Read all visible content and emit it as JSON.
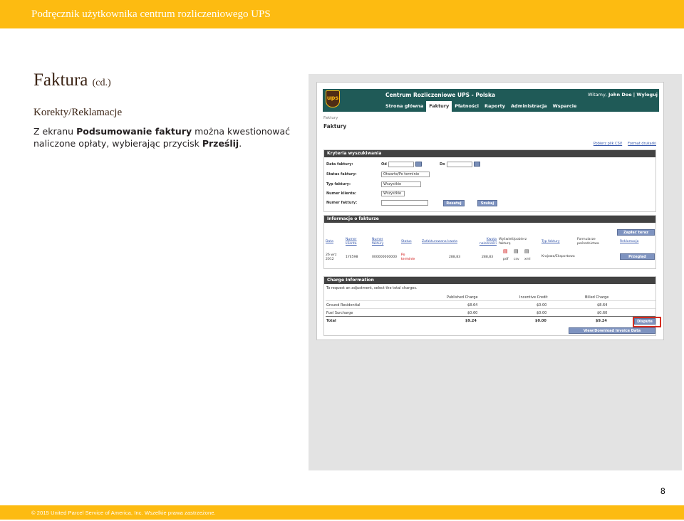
{
  "header": {
    "title": "Podręcznik użytkownika centrum rozliczeniowego UPS"
  },
  "page": {
    "title": "Faktura",
    "title_suffix": "(cd.)",
    "section": "Korekty/Reklamacje",
    "instruction_pre": "Z ekranu ",
    "instruction_bold1": "Podsumowanie faktury",
    "instruction_mid": " można kwestionować naliczone opłaty, wybierając przycisk ",
    "instruction_bold2": "Prześlij",
    "instruction_end": ".",
    "number": "8"
  },
  "footer": {
    "text": "© 2015 United Parcel Service of America, Inc. Wszelkie prawa zastrzeżone."
  },
  "screenshot": {
    "logo": "ups",
    "app_name": "Centrum Rozliczeniowe UPS - Polska",
    "welcome": "Witamy,",
    "user": "John Doe",
    "logout": "| Wyloguj",
    "nav": [
      "Strona główna",
      "Faktury",
      "Płatności",
      "Raporty",
      "Administracja",
      "Wsparcie"
    ],
    "nav_active_index": 1,
    "breadcrumb": "Faktury",
    "heading": "Faktury",
    "links": [
      "Pobierz plik CSV",
      "Format drukarki"
    ],
    "criteria": {
      "title": "Kryteria wyszukiwania",
      "date_label": "Data faktury:",
      "from_label": "Od",
      "to_label": "Do",
      "status_label": "Status faktury:",
      "status_value": "Otwarte/Po terminie",
      "type_label": "Typ faktury:",
      "type_value": "Wszystkie",
      "client_label": "Numer klienta:",
      "client_value": "Wszystkie",
      "number_label": "Numer faktury:",
      "reset": "Resetuj",
      "search": "Szukaj"
    },
    "info": {
      "title": "Informacje o fakturze",
      "pay_now": "Zapłać teraz",
      "headers": [
        "Data",
        "Numer klienta",
        "Numer faktury",
        "Status",
        "Zafakturowana kwota",
        "Kwota należności",
        "Wyświetl/pobierz fakturę",
        "Typ faktury",
        "Formularze pośrednictwa",
        "Reklamacja"
      ],
      "row": {
        "date": "26 wrz 2012",
        "client": "1YE598",
        "number": "000000000000",
        "status": "Po terminie",
        "invoiced": "288,83",
        "due": "288,83",
        "formats": [
          "pdf",
          "csv",
          "xml"
        ],
        "type": "Krajowa/Eksportowa",
        "review": "Przegląd"
      }
    },
    "charge": {
      "title": "Charge Information",
      "instruction": "To request an adjustment, select the total charges.",
      "columns": [
        "Published Charge",
        "Incentive Credit",
        "Billed Charge"
      ],
      "rows": [
        {
          "name": "Ground Residential",
          "published": "$8.64",
          "incentive": "$0.00",
          "billed": "$8.64"
        },
        {
          "name": "Fuel Surcharge",
          "published": "$0.60",
          "incentive": "$0.00",
          "billed": "$0.60"
        },
        {
          "name": "Total",
          "published": "$9.24",
          "incentive": "$0.00",
          "billed": "$9.24"
        }
      ],
      "dispute": "Dispute",
      "view_download": "View/Download Invoice Data"
    }
  }
}
